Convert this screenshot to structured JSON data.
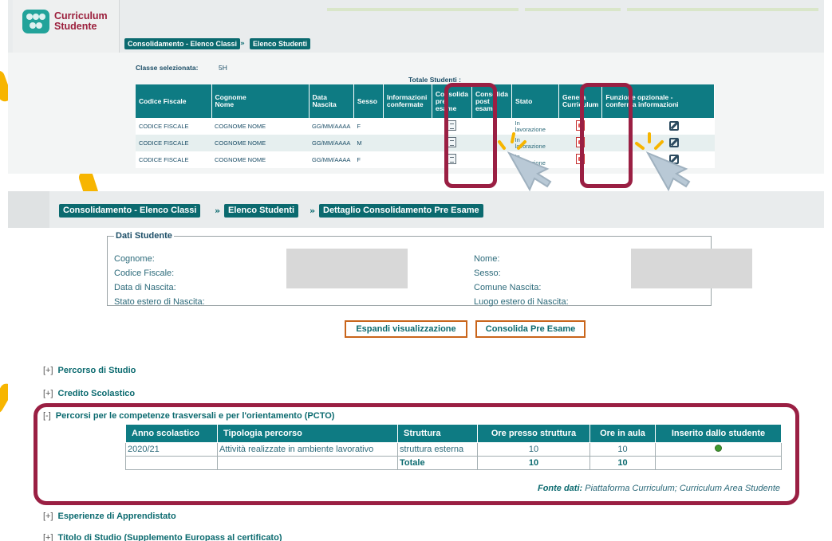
{
  "colors": {
    "accent": "#0e7b83",
    "highlight": "#9a1f43",
    "button_border": "#c9651b",
    "decor": "#f7b500"
  },
  "app": {
    "logo_line1": "Curriculum",
    "logo_line2": "Studente"
  },
  "top": {
    "breadcrumb": [
      "Consolidamento - Elenco Classi",
      "»",
      "Elenco Studenti"
    ],
    "class_label": "Classe selezionata:",
    "class_value": "5H",
    "total_label": "Totale Studenti :",
    "headers": {
      "cf": "Codice Fiscale",
      "cognome": "Cognome",
      "nome": "Nome",
      "data": "Data",
      "nascita": "Nascita",
      "sesso": "Sesso",
      "info1": "Informazioni",
      "info2": "confermate",
      "pre1": "Consolida",
      "pre2": "pre",
      "pre3": "esame",
      "post1": "Consolida",
      "post2": "post",
      "post3": "esame",
      "stato": "Stato",
      "gen1": "Genera",
      "gen2": "Curriculum",
      "fun1": "Funzione opzionale -",
      "fun2": "conferma informazioni"
    },
    "rows": [
      {
        "cf": "CODICE FISCALE",
        "nome": "COGNOME NOME",
        "data": "GG/MM/AAAA",
        "sesso": "F",
        "stato1": "In",
        "stato2": "lavorazione"
      },
      {
        "cf": "CODICE FISCALE",
        "nome": "COGNOME NOME",
        "data": "GG/MM/AAAA",
        "sesso": "M",
        "stato1": "In",
        "stato2": "lavorazione"
      },
      {
        "cf": "CODICE FISCALE",
        "nome": "COGNOME NOME",
        "data": "GG/MM/AAAA",
        "sesso": "F",
        "stato1": "In",
        "stato2": "lavorazione"
      }
    ],
    "icons": {
      "pre": "document-icon",
      "curriculum": "pdf-icon",
      "funzione": "edit-icon"
    }
  },
  "bottom": {
    "breadcrumb": [
      "Consolidamento - Elenco Classi",
      "»",
      "Elenco Studenti",
      "»",
      "Dettaglio Consolidamento Pre Esame"
    ],
    "legend": "Dati Studente",
    "labels_left": [
      "Cognome:",
      "Codice Fiscale:",
      "Data di Nascita:",
      "Stato estero di Nascita:"
    ],
    "labels_right": [
      "Nome:",
      "Sesso:",
      "Comune Nascita:",
      "Luogo estero di Nascita:"
    ],
    "btn_espandi": "Espandi visualizzazione",
    "btn_consolida": "Consolida Pre Esame",
    "sections": [
      {
        "toggle": "[+]",
        "title": "Percorso di Studio"
      },
      {
        "toggle": "[+]",
        "title": "Credito Scolastico"
      },
      {
        "toggle": "[-]",
        "title": "Percorsi per le competenze trasversali e per l'orientamento (PCTO)"
      },
      {
        "toggle": "[+]",
        "title": "Esperienze di Apprendistato"
      },
      {
        "toggle": "[+]",
        "title": "Titolo di Studio (Supplemento Europass al certificato)"
      }
    ],
    "pcto": {
      "headers": [
        "Anno scolastico",
        "Tipologia percorso",
        "Struttura",
        "Ore presso struttura",
        "Ore in aula",
        "Inserito dallo studente"
      ],
      "row": {
        "anno": "2020/21",
        "tipologia": "Attività realizzate in ambiente lavorativo",
        "struttura": "struttura esterna",
        "ore_struttura": "10",
        "ore_aula": "10"
      },
      "total": {
        "label": "Totale",
        "ore_struttura": "10",
        "ore_aula": "10"
      },
      "fonte_label": "Fonte dati:",
      "fonte_value": "Piattaforma Curriculum; Curriculum Area Studente"
    }
  }
}
